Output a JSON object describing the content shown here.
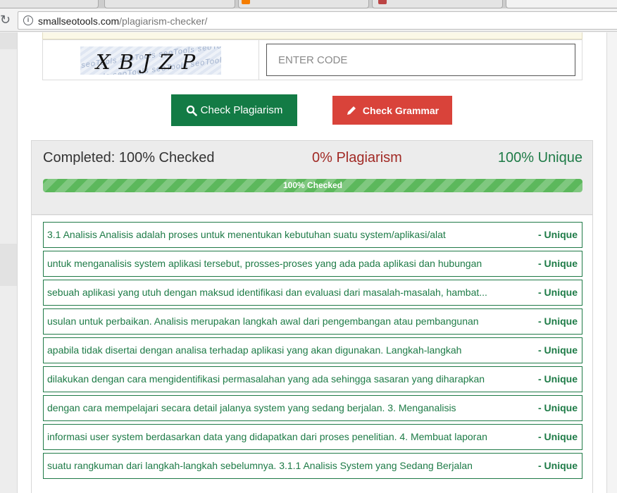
{
  "browser": {
    "url_host": "smallseotools.com",
    "url_path": "/plagiarism-checker/"
  },
  "captcha": {
    "text": "XBJZP",
    "input_placeholder": "ENTER CODE"
  },
  "buttons": {
    "check_plagiarism": "Check Plagiarism",
    "check_grammar": "Check Grammar"
  },
  "summary": {
    "completed": "Completed: 100% Checked",
    "plagiarism": "0% Plagiarism",
    "unique": "100% Unique",
    "progress_percent": 100,
    "progress_label": "100% Checked"
  },
  "results": [
    {
      "text": "3.1 Analisis Analisis adalah proses untuk menentukan kebutuhan suatu system/aplikasi/alat",
      "status": "- Unique"
    },
    {
      "text": "untuk menganalisis system aplikasi tersebut, prosses-proses yang ada pada aplikasi dan hubungan",
      "status": "- Unique"
    },
    {
      "text": "sebuah aplikasi yang utuh dengan maksud identifikasi dan evaluasi dari masalah-masalah, hambat...",
      "status": "- Unique"
    },
    {
      "text": "usulan untuk perbaikan. Analisis merupakan langkah awal dari pengembangan atau pembangunan",
      "status": "- Unique"
    },
    {
      "text": "apabila tidak disertai dengan analisa terhadap aplikasi yang akan digunakan. Langkah-langkah",
      "status": "- Unique"
    },
    {
      "text": "dilakukan dengan cara mengidentifikasi permasalahan yang ada sehingga sasaran yang diharapkan",
      "status": "- Unique"
    },
    {
      "text": "dengan cara mempelajari secara detail jalanya system yang sedang berjalan. 3. Menganalisis",
      "status": "- Unique"
    },
    {
      "text": "informasi user system berdasarkan data yang didapatkan dari proses penelitian. 4. Membuat laporan",
      "status": "- Unique"
    },
    {
      "text": "suatu rangkuman dari langkah-langkah sebelumnya. 3.1.1 Analisis System yang Sedang Berjalan",
      "status": "- Unique"
    }
  ],
  "colors": {
    "green": "#1e7b47",
    "button_green": "#137b45",
    "button_red": "#d9433a",
    "plagiarism_red": "#a12a25",
    "progress_green": "#5cb85c"
  }
}
